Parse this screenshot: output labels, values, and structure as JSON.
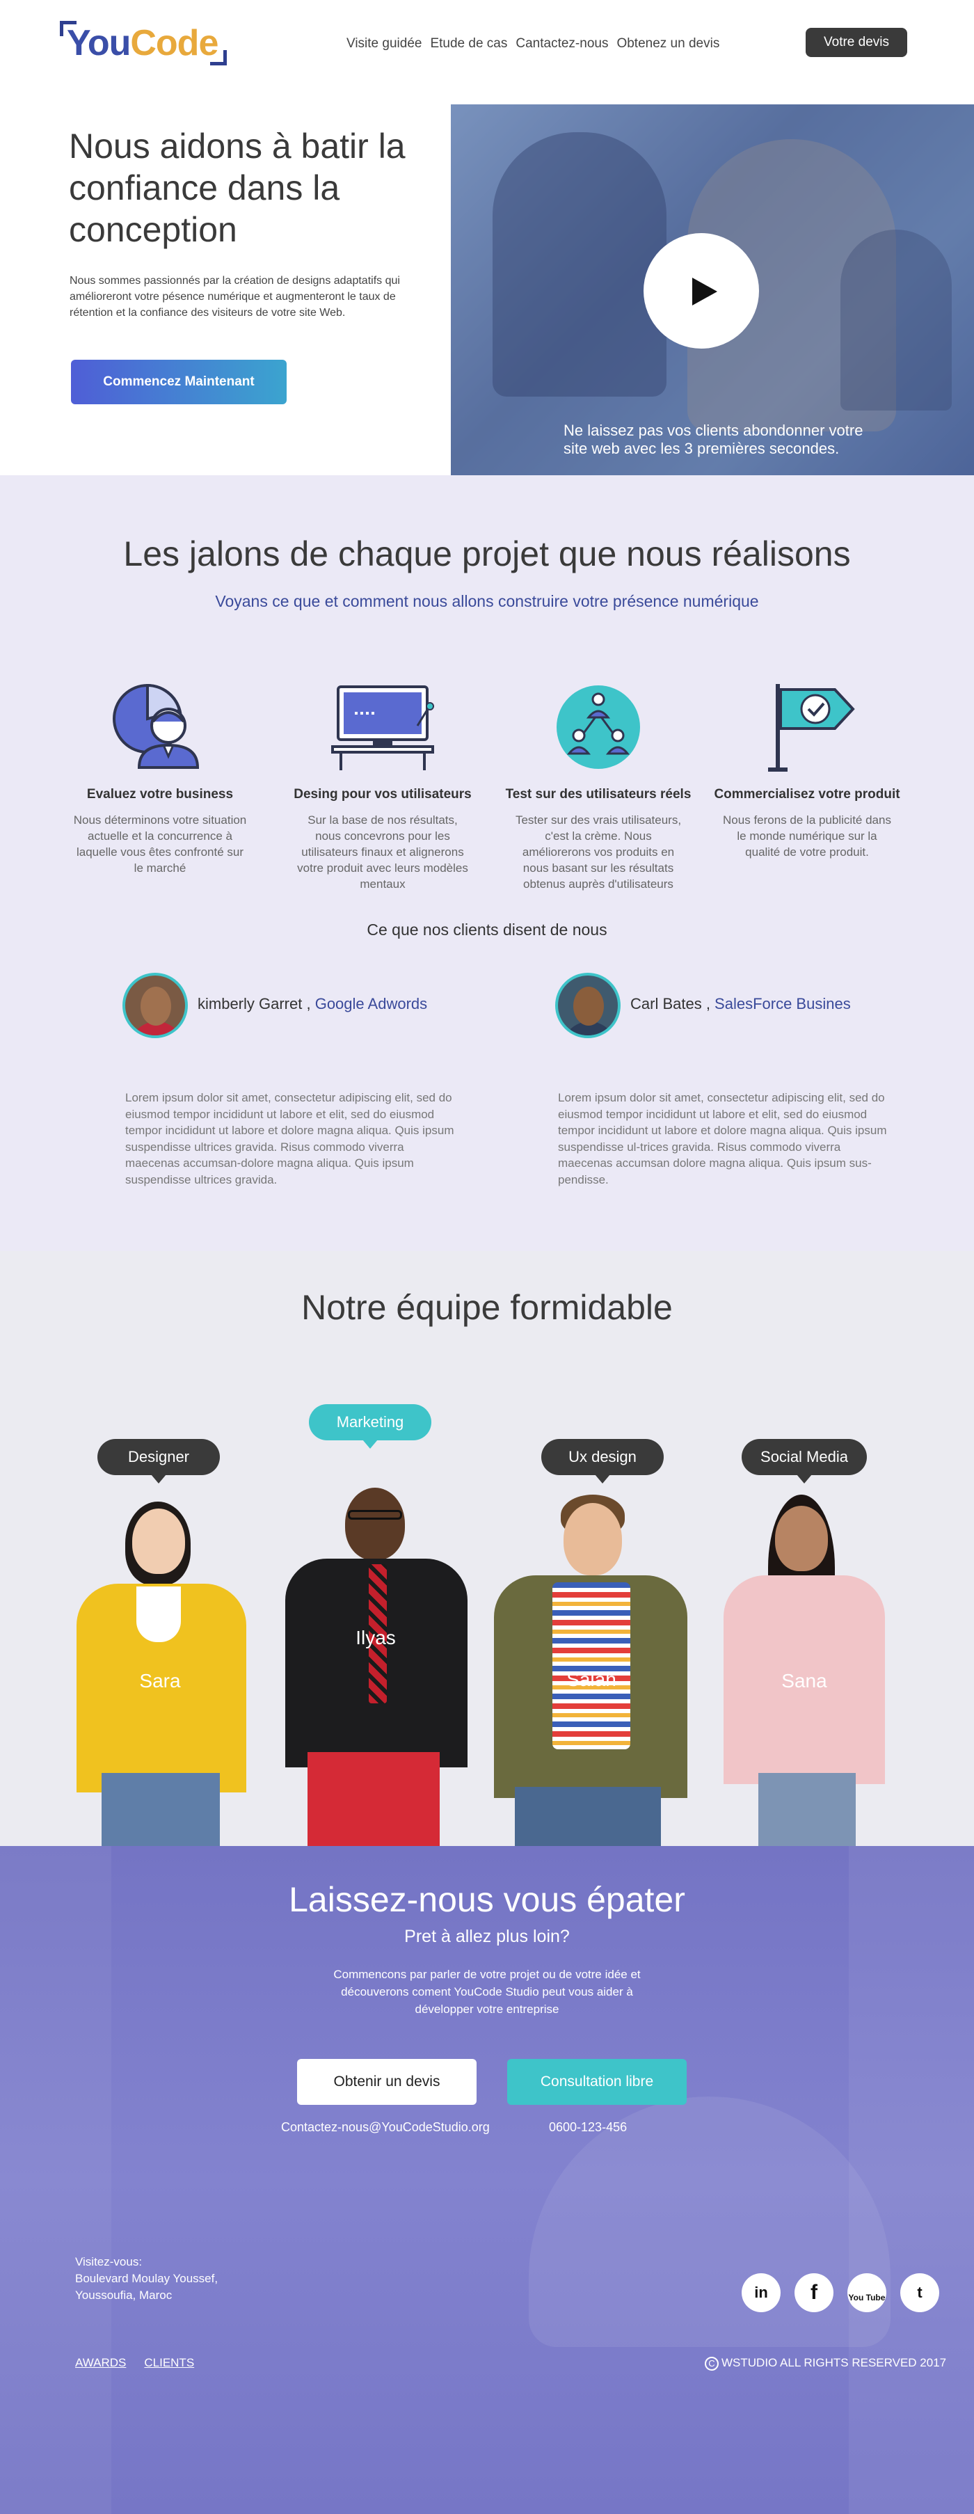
{
  "logo": {
    "part1": "You",
    "part2": "Code",
    "tagline": ""
  },
  "nav": [
    "Visite guidée",
    "Etude de cas",
    "Cantactez-nous",
    "Obtenez un devis"
  ],
  "header_button": "Votre devis",
  "hero": {
    "title": "Nous aidons à batir la confiance dans la conception",
    "description": "Nous sommes passionnés par la création de designs adaptatifs qui amélioreront votre pésence numérique et augmenteront le taux de rétention et la confiance des visiteurs de votre site Web.",
    "button": "Commencez Maintenant",
    "video_caption": "Ne laissez pas vos clients abondonner votre site web avec les 3 premières secondes."
  },
  "process": {
    "title": "Les jalons de chaque projet que nous réalisons",
    "subtitle": "Voyans ce que et comment nous allons construire votre présence numérique",
    "steps": [
      {
        "icon": "business-analysis-icon",
        "title": "Evaluez votre business",
        "text": "Nous déterminons votre situation actuelle et la concurrence à laquelle vous êtes confronté sur le marché"
      },
      {
        "icon": "computer-design-icon",
        "title": "Desing pour vos utilisateurs",
        "text": "Sur la base de nos résultats, nous concevrons pour les utilisateurs finaux et alignerons votre produit avec leurs modèles mentaux"
      },
      {
        "icon": "user-network-icon",
        "title": "Test sur des utilisateurs réels",
        "text": "Tester sur des vrais utilisateurs, c'est la crème. Nous améliorerons vos produits en nous basant sur les résultats obtenus auprès d'utilisateurs"
      },
      {
        "icon": "flag-check-icon",
        "title": "Commercialisez votre produit",
        "text": "Nous ferons de la publicité dans le monde numérique sur la qualité de votre produit."
      }
    ],
    "testimonials_title": "Ce que nos clients disent de nous",
    "testimonials": [
      {
        "name": "kimberly Garret , ",
        "company": "Google Adwords",
        "text": "Lorem ipsum dolor sit amet, consectetur adipiscing elit, sed do eiusmod tempor incididunt ut labore et elit, sed do eiusmod tempor incididunt ut labore et dolore magna aliqua. Quis ipsum suspendisse ultrices gravida. Risus commodo viverra maecenas accumsan-dolore magna aliqua. Quis ipsum suspendisse ultrices gravida."
      },
      {
        "name": "Carl Bates , ",
        "company": "SalesForce Busines",
        "text": "Lorem ipsum dolor sit amet, consectetur adipiscing elit, sed do eiusmod tempor incididunt ut labore et elit, sed do eiusmod tempor incididunt ut labore et dolore magna aliqua. Quis ipsum suspendisse ul-trices gravida. Risus commodo viverra maecenas accumsan dolore magna aliqua. Quis ipsum sus-pendisse."
      }
    ]
  },
  "team": {
    "title": "Notre équipe formidable",
    "members": [
      {
        "role": "Designer",
        "name": "Sara"
      },
      {
        "role": "Marketing",
        "name": "Ilyas"
      },
      {
        "role": "Ux design",
        "name": "Salah"
      },
      {
        "role": "Social Media",
        "name": "Sana"
      }
    ]
  },
  "cta": {
    "title": "Laissez-nous vous épater",
    "subtitle": "Pret à allez plus loin?",
    "text": "Commencons par parler de votre projet ou de votre idée et découverons coment YouCode Studio peut vous aider à développer votre entreprise",
    "button_quote": "Obtenir un devis",
    "button_consult": "Consultation libre",
    "email": "Contactez-nous@YouCodeStudio.org",
    "phone": "0600-123-456"
  },
  "footer": {
    "visit_label": "Visitez-vous:",
    "address_line1": "Boulevard Moulay Youssef,",
    "address_line2": "Youssoufia,  Maroc",
    "links": [
      "AWARDS",
      "CLIENTS"
    ],
    "copyright": "WSTUDIO ALL RIGHTS RESERVED 2017",
    "socials": [
      {
        "icon": "linkedin-icon",
        "label": "in"
      },
      {
        "icon": "facebook-icon",
        "label": "f"
      },
      {
        "icon": "youtube-icon",
        "label": "You Tube"
      },
      {
        "icon": "twitter-icon",
        "label": "t"
      }
    ]
  },
  "colors": {
    "accent": "#3a4a9a",
    "teal": "#3ec4c9",
    "lavender": "#ebe9f6",
    "cta": "#7b7bc9",
    "dark": "#3a3a3a"
  }
}
